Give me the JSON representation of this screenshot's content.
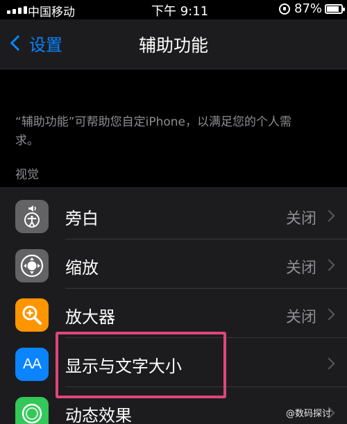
{
  "status_bar": {
    "carrier": "中国移动",
    "time": "下午 9:11",
    "battery": "87%"
  },
  "nav": {
    "back_label": "设置",
    "title": "辅助功能"
  },
  "description": "“辅助功能”可帮助您自定iPhone，以满足您的个人需求。",
  "section_header": "视觉",
  "rows": [
    {
      "label": "旁白",
      "value": "关闭",
      "icon": "voiceover-icon",
      "icon_color": "#636366"
    },
    {
      "label": "缩放",
      "value": "关闭",
      "icon": "zoom-icon",
      "icon_color": "#636366"
    },
    {
      "label": "放大器",
      "value": "关闭",
      "icon": "magnifier-icon",
      "icon_color": "#ff9500"
    },
    {
      "label": "显示与文字大小",
      "value": "",
      "icon": "text-size-icon",
      "icon_glyph": "AA",
      "icon_color": "#0a84ff"
    },
    {
      "label": "动态效果",
      "value": "",
      "icon": "motion-icon",
      "icon_color": "#34c759"
    }
  ],
  "highlight_color": "#e0457b",
  "watermark": "@数码探讨"
}
